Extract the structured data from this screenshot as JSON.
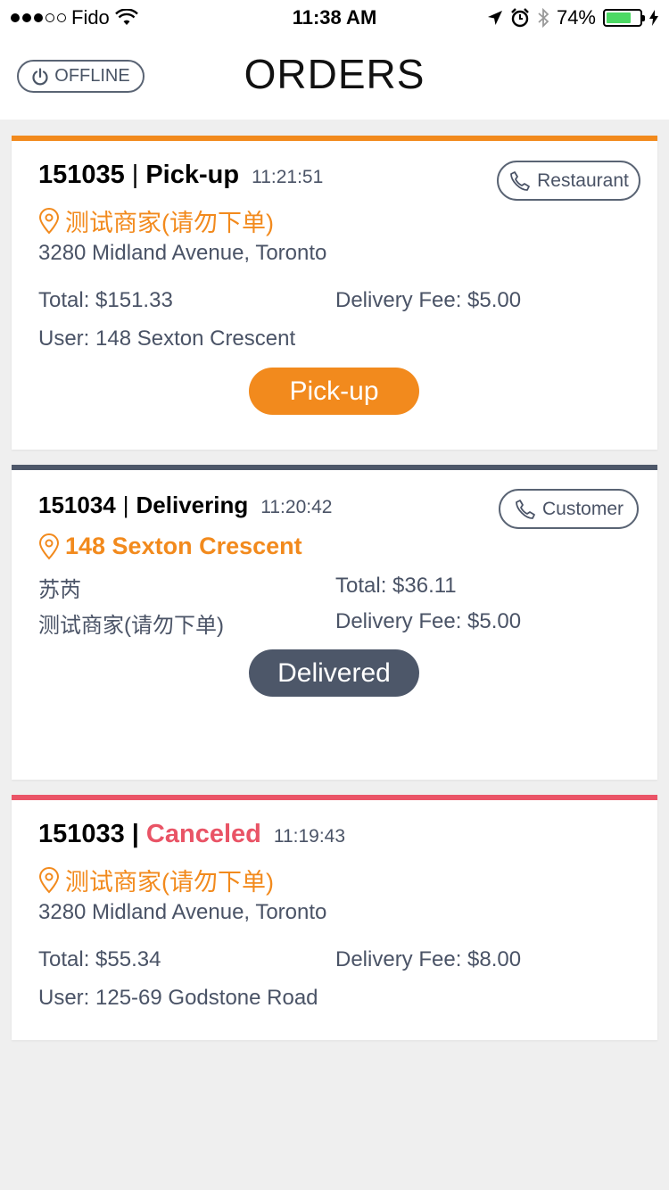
{
  "status_bar": {
    "carrier": "Fido",
    "time": "11:38 AM",
    "battery": "74%",
    "battery_level": 0.74
  },
  "nav": {
    "offline_label": "OFFLINE",
    "title": "ORDERS"
  },
  "orders": [
    {
      "id": "151035",
      "status": "Pick-up",
      "time": "11:21:51",
      "call_label": "Restaurant",
      "location": "测试商家(请勿下单)",
      "address": "3280 Midland Avenue, Toronto",
      "total": "Total: $151.33",
      "delivery_fee": "Delivery Fee: $5.00",
      "user": "User: 148 Sexton Crescent",
      "action": "Pick-up",
      "accent": "#f28a1d"
    },
    {
      "id": "151034",
      "status": "Delivering",
      "time": "11:20:42",
      "call_label": "Customer",
      "location": "148 Sexton Crescent",
      "customer_name": "苏芮",
      "restaurant": "测试商家(请勿下单)",
      "total": "Total: $36.11",
      "delivery_fee": "Delivery Fee: $5.00",
      "action": "Delivered",
      "accent": "#4d5769"
    },
    {
      "id": "151033",
      "status": "Canceled",
      "time": "11:19:43",
      "location": "测试商家(请勿下单)",
      "address": "3280 Midland Avenue, Toronto",
      "total": "Total: $55.34",
      "delivery_fee": "Delivery Fee: $8.00",
      "user": "User: 125-69 Godstone Road",
      "accent": "#ea5467"
    }
  ],
  "icons": {
    "power": "power-icon",
    "phone": "phone-icon",
    "pin": "location-pin-icon"
  }
}
